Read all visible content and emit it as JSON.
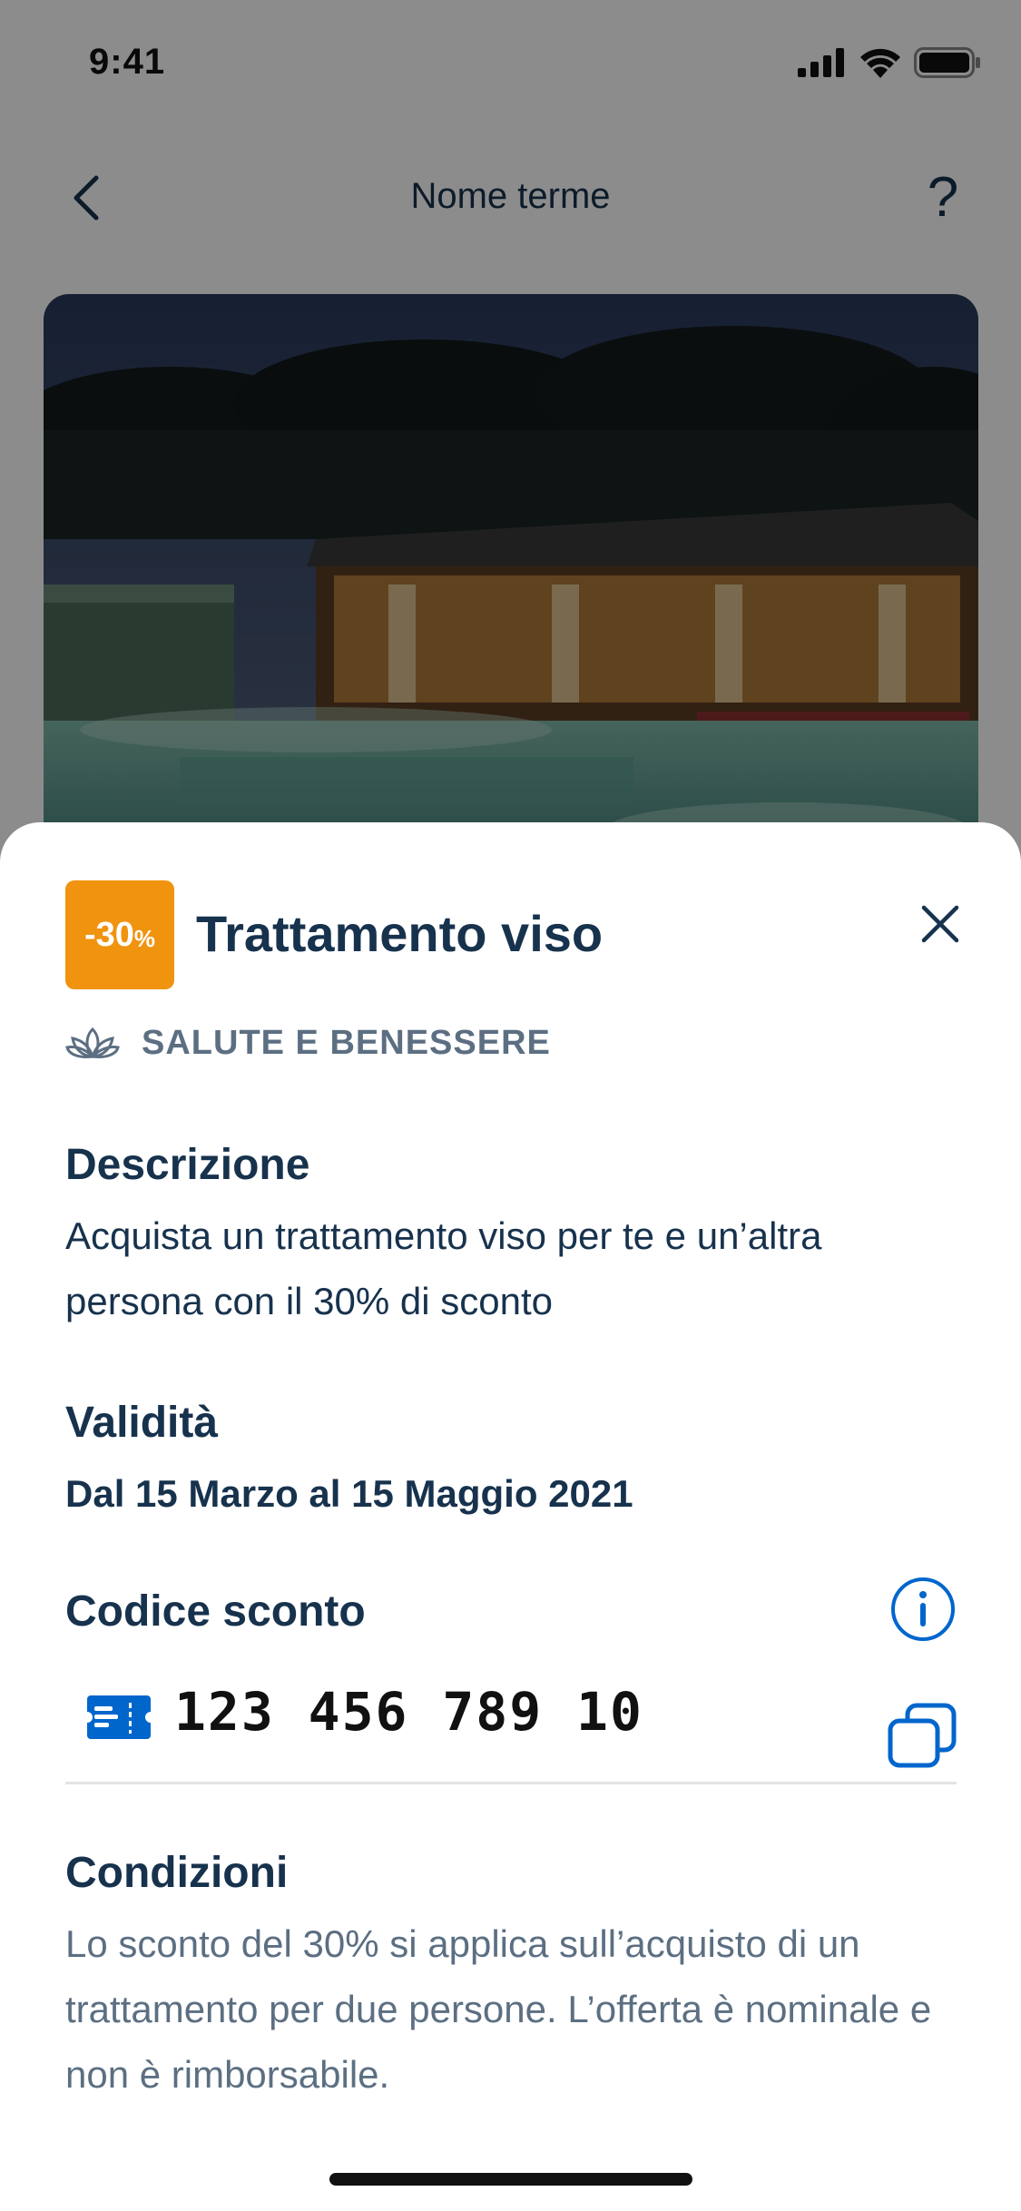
{
  "status_bar": {
    "time": "9:41"
  },
  "nav": {
    "title": "Nome terme",
    "help": "?"
  },
  "offer": {
    "badge_value": "-30",
    "badge_unit": "%",
    "title": "Trattamento viso",
    "category": "SALUTE E BENESSERE"
  },
  "description": {
    "title": "Descrizione",
    "text": "Acquista un trattamento viso per te e un’altra persona con il 30% di sconto"
  },
  "validity": {
    "title": "Validità",
    "value": "Dal 15 Marzo al 15 Maggio 2021"
  },
  "discount_code": {
    "title": "Codice sconto",
    "value": "123 456 789 10"
  },
  "conditions": {
    "title": "Condizioni",
    "text": "Lo sconto del 30% si applica sull’acquisto di un trattamento per due persone. L’offerta è nominale e non è rimborsabile."
  },
  "colors": {
    "accent": "#0066cc",
    "badge": "#f0930e",
    "text": "#17324d",
    "muted": "#5c6f82"
  },
  "icons": [
    "back-icon",
    "help-icon",
    "close-icon",
    "lotus-icon",
    "info-icon",
    "ticket-icon",
    "copy-icon"
  ]
}
